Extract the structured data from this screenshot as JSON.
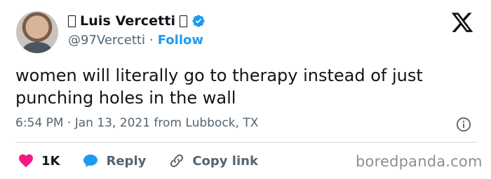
{
  "author": {
    "display_name": "Luis Vercetti",
    "handle": "@97Vercetti",
    "separator": "·",
    "follow_label": "Follow"
  },
  "tweet": {
    "text": "women will literally go to therapy instead of just punching holes in the wall",
    "meta": "6:54 PM · Jan 13, 2021 from Lubbock, TX"
  },
  "actions": {
    "likes_count": "1K",
    "reply_label": "Reply",
    "copy_link_label": "Copy link"
  },
  "watermark": "boredpanda.com",
  "icons": {
    "verified": "verified-badge-icon",
    "x_logo": "x-logo-icon",
    "info": "info-icon",
    "heart": "heart-icon",
    "reply": "reply-bubble-icon",
    "link": "link-icon"
  },
  "colors": {
    "accent": "#1d9bf0",
    "heart": "#f91880",
    "text": "#0f1419",
    "muted": "#536471"
  }
}
